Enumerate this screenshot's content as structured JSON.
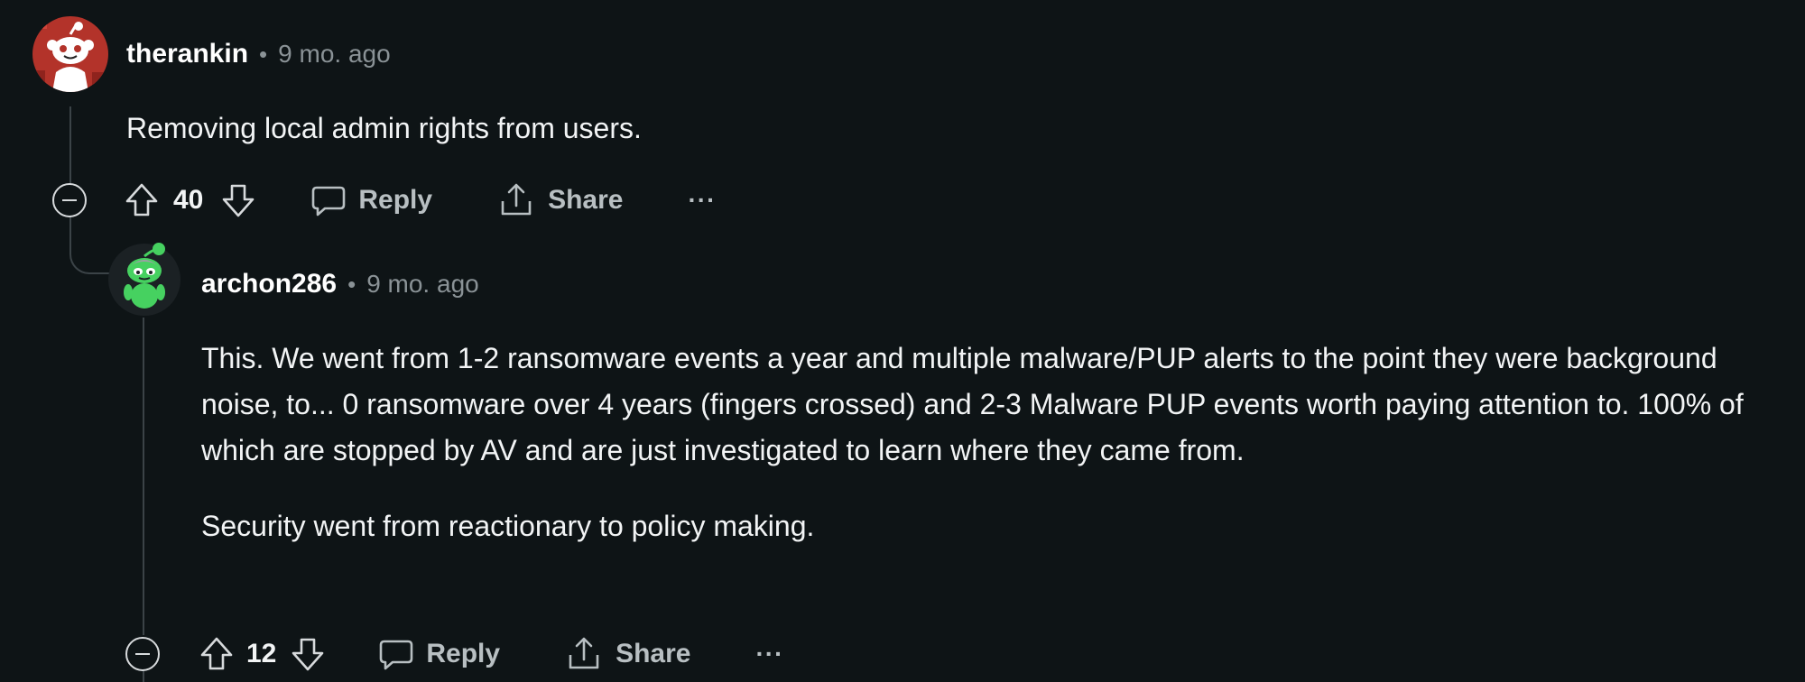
{
  "colors": {
    "background": "#0e1416",
    "username": "#ffffff",
    "muted": "#8a9296",
    "thread_line": "#3b4347"
  },
  "comments": [
    {
      "username": "therankin",
      "separator": "•",
      "timestamp": "9 mo. ago",
      "avatar_icon": "snoo-avatar-red",
      "paragraphs": [
        "Removing local admin rights from users."
      ],
      "score": "40",
      "reply_label": "Reply",
      "share_label": "Share",
      "more_label": "···"
    },
    {
      "username": "archon286",
      "separator": "•",
      "timestamp": "9 mo. ago",
      "avatar_icon": "snoo-avatar-green",
      "paragraphs": [
        "This. We went from 1-2 ransomware events a year and multiple malware/PUP alerts to the point they were background noise, to... 0 ransomware over 4 years (fingers crossed) and 2-3 Malware PUP events worth paying attention to. 100% of which are stopped by AV and are just investigated to learn where they came from.",
        "Security went from reactionary to policy making."
      ],
      "score": "12",
      "reply_label": "Reply",
      "share_label": "Share",
      "more_label": "···"
    }
  ]
}
